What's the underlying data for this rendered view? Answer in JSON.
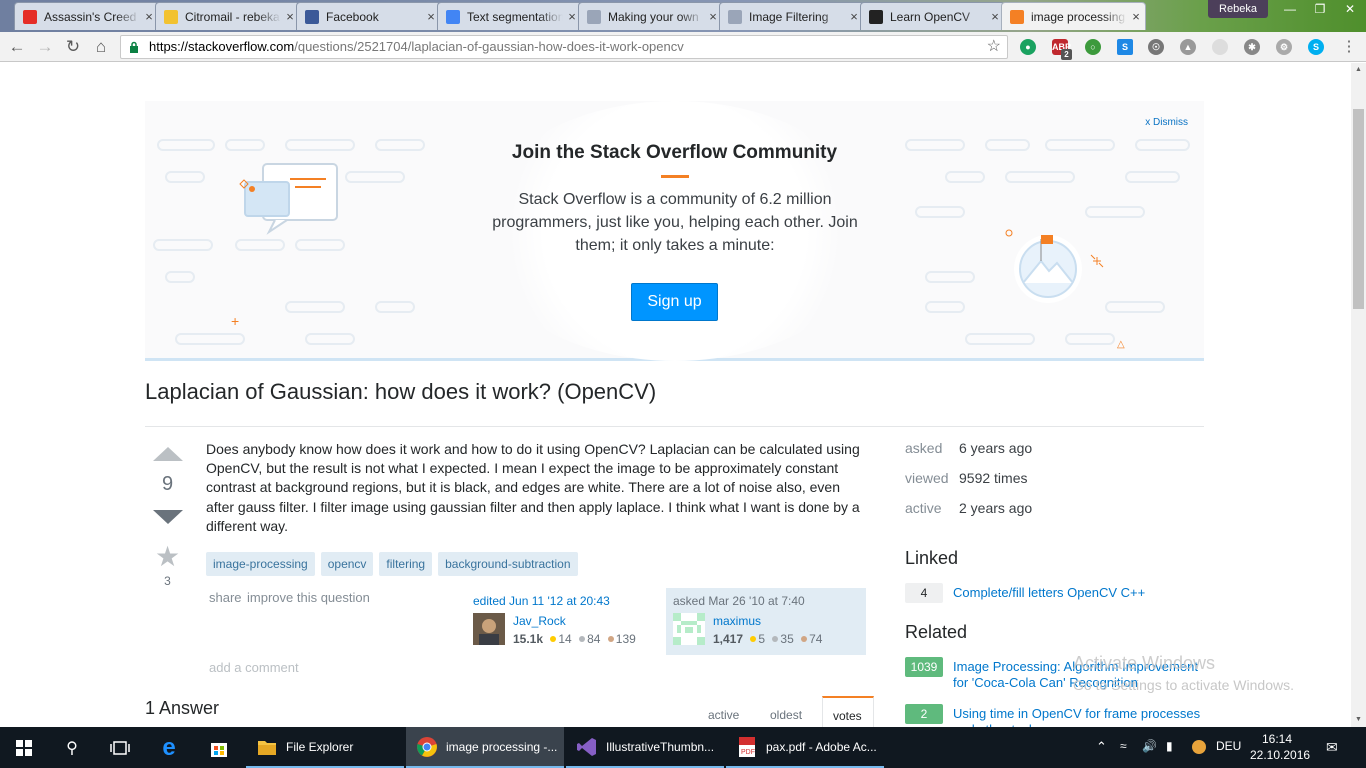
{
  "browser": {
    "tabs": [
      {
        "title": "Assassin's Creed",
        "icon": "youtube-icon",
        "color": "#e52d27"
      },
      {
        "title": "Citromail - rebeka",
        "icon": "mail-icon",
        "color": "#f2c230"
      },
      {
        "title": "Facebook",
        "icon": "facebook-icon",
        "color": "#3b5998"
      },
      {
        "title": "Text segmentation",
        "icon": "docs-icon",
        "color": "#4285f4"
      },
      {
        "title": "Making your own",
        "icon": "page-icon",
        "color": "#9aa5b8"
      },
      {
        "title": "Image Filtering",
        "icon": "page-icon",
        "color": "#9aa5b8"
      },
      {
        "title": "Learn OpenCV",
        "icon": "opencv-icon",
        "color": "#222"
      },
      {
        "title": "image processing - ",
        "icon": "stackoverflow-icon",
        "color": "#f48024",
        "active": true
      }
    ],
    "profile_name": "Rebeka",
    "url_host": "https://stackoverflow.com",
    "url_path": "/questions/2521704/laplacian-of-gaussian-how-does-it-work-opencv",
    "ext_badge": "2"
  },
  "hero": {
    "dismiss": "x Dismiss",
    "title": "Join the Stack Overflow Community",
    "text": "Stack Overflow is a community of 6.2 million programmers, just like you, helping each other. Join them; it only takes a minute:",
    "signup": "Sign up"
  },
  "question": {
    "title": "Laplacian of Gaussian: how does it work? (OpenCV)",
    "votes": "9",
    "favorites": "3",
    "body": "Does anybody know how does it work and how to do it using OpenCV? Laplacian can be calculated using OpenCV, but the result is not what I expected. I mean I expect the image to be approximately constant contrast at background regions, but it is black, and edges are white. There are a lot of noise also, even after gauss filter. I filter image using gaussian filter and then apply laplace. I think what I want is done by a different way.",
    "tags": [
      "image-processing",
      "opencv",
      "filtering",
      "background-subtraction"
    ],
    "share": "share",
    "improve": "improve this question",
    "edited": {
      "when": "edited Jun 11 '12 at 20:43",
      "user": "Jav_Rock",
      "rep": "15.1k",
      "gold": "14",
      "silver": "84",
      "bronze": "139"
    },
    "asked": {
      "when": "asked Mar 26 '10 at 7:40",
      "user": "maximus",
      "rep": "1,417",
      "gold": "5",
      "silver": "35",
      "bronze": "74"
    },
    "add_comment": "add a comment"
  },
  "answers": {
    "count_label": "1 Answer",
    "sort_tabs": [
      "active",
      "oldest",
      "votes"
    ],
    "selected": "votes"
  },
  "sidebar": {
    "stats": [
      {
        "key": "asked",
        "value": "6 years ago"
      },
      {
        "key": "viewed",
        "value": "9592 times"
      },
      {
        "key": "active",
        "value": "2 years ago"
      }
    ],
    "linked_title": "Linked",
    "linked": [
      {
        "score": "4",
        "title": "Complete/fill letters OpenCV C++"
      }
    ],
    "related_title": "Related",
    "related": [
      {
        "score": "1039",
        "title": "Image Processing: Algorithm Improvement for 'Coca-Cola Can' Recognition"
      },
      {
        "score": "2",
        "title": "Using time in OpenCV for frame processes and other tasks"
      }
    ]
  },
  "watermark": {
    "line1": "Activate Windows",
    "line2": "Go to Settings to activate Windows."
  },
  "taskbar": {
    "apps": [
      {
        "label": "File Explorer",
        "icon": "folder-icon"
      },
      {
        "label": "image processing -...",
        "icon": "chrome-icon"
      },
      {
        "label": "IllustrativeThumbn...",
        "icon": "visual-studio-icon"
      },
      {
        "label": "pax.pdf - Adobe Ac...",
        "icon": "acrobat-icon"
      }
    ],
    "language": "DEU",
    "time": "16:14",
    "date": "22.10.2016"
  }
}
